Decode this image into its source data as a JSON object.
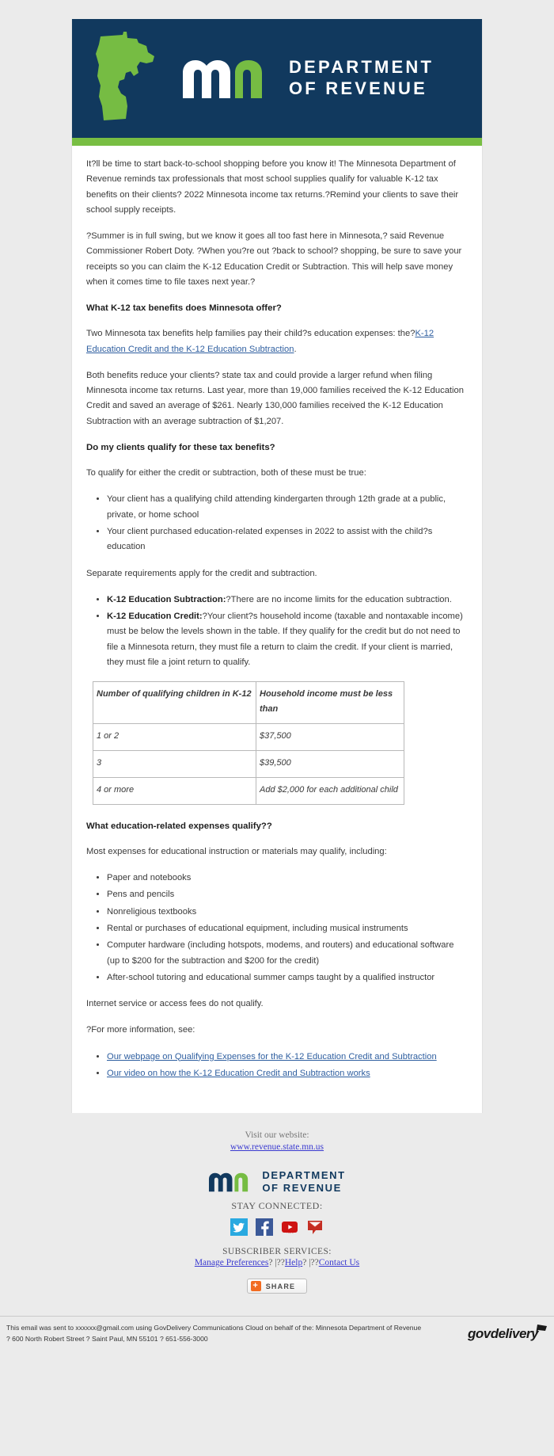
{
  "banner": {
    "map_icon": "minnesota-state-outline",
    "logo_icon": "mn-monogram",
    "dept_line1": "DEPARTMENT",
    "dept_line2": "OF REVENUE"
  },
  "article": {
    "intro": "It?ll be time to start back-to-school shopping before you know it! The Minnesota Department of Revenue reminds tax professionals that most school supplies qualify for valuable K-12 tax benefits on their clients? 2022 Minnesota income tax returns.?Remind your clients to save their school supply receipts.",
    "quote": "?Summer is in full swing, but we know it goes all too fast here in Minnesota,? said Revenue Commissioner Robert Doty. ?When you?re out ?back to school? shopping, be sure to save your receipts so you can claim the K-12 Education Credit or Subtraction. This will help save money when it comes time to file taxes next year.?",
    "heading_benefits": "What K-12 tax benefits does Minnesota offer?",
    "two_benefits_lead": "Two Minnesota tax benefits help families pay their child?s education expenses: the?",
    "two_benefits_link": "K-12 Education Credit and the K-12 Education Subtraction",
    "two_benefits_tail": ".",
    "both_benefits": "Both benefits reduce your clients? state tax and could provide a larger refund when filing Minnesota income tax returns. Last year, more than 19,000 families received the K-12 Education Credit and saved an average of $261. Nearly 130,000 families received the K-12 Education Subtraction with an average subtraction of $1,207.",
    "heading_qualify": "Do my clients qualify for these tax benefits?",
    "qualify_lead": "To qualify for either the credit or subtraction, both of these must be true:",
    "qualify_items": [
      "Your client has a qualifying child attending kindergarten through 12th grade at a public, private, or home school",
      "Your client purchased education-related expenses in 2022 to assist with the child?s education"
    ],
    "separate_requirements": "Separate requirements apply for the credit and subtraction.",
    "requirement_items": [
      {
        "label": "K-12 Education Subtraction:",
        "text": "?There are no income limits for the education subtraction."
      },
      {
        "label": "K-12 Education Credit:",
        "text": "?Your client?s household income (taxable and nontaxable income) must be below the levels shown in the table. If they qualify for the credit but do not need to file a Minnesota return, they must file a return to claim the credit. If your client is married, they must file a joint return to qualify."
      }
    ],
    "heading_expenses": "What education-related expenses qualify??",
    "expenses_lead": "Most expenses for educational instruction or materials may qualify, including:",
    "expense_items": [
      "Paper and notebooks",
      "Pens and pencils",
      "Nonreligious textbooks",
      "Rental or purchases of educational equipment, including musical instruments",
      "Computer hardware (including hotspots, modems, and routers) and educational software (up to $200 for the subtraction and $200 for the credit)",
      "After-school tutoring and educational summer camps taught by a qualified instructor"
    ],
    "internet_note": "Internet service or access fees do not qualify.",
    "more_info_lead": "?For more information, see:",
    "more_info_links": [
      "Our webpage on Qualifying Expenses for the K-12 Education Credit and Subtraction",
      "Our video on how the K-12 Education Credit and Subtraction works"
    ]
  },
  "income_table": {
    "headers": [
      "Number of qualifying children in K-12",
      "Household income must be less than"
    ],
    "rows": [
      [
        "1 or 2",
        "$37,500"
      ],
      [
        "3",
        "$39,500"
      ],
      [
        "4 or more",
        "Add $2,000 for each additional child"
      ]
    ]
  },
  "footer": {
    "visit_label": "Visit our website:",
    "visit_link": "www.revenue.state.mn.us",
    "dept_line1": "DEPARTMENT",
    "dept_line2": "OF REVENUE",
    "stay_connected": "STAY CONNECTED:",
    "social": [
      {
        "name": "twitter-icon"
      },
      {
        "name": "facebook-icon"
      },
      {
        "name": "youtube-icon"
      },
      {
        "name": "email-icon"
      }
    ],
    "subscriber_label": "SUBSCRIBER SERVICES:",
    "manage_preferences": "Manage Preferences",
    "sep1": "? |??",
    "help": "Help",
    "sep2": "? |??",
    "contact_us": "Contact Us",
    "share_label": "SHARE",
    "share_icon": "share-plus-icon"
  },
  "legal": {
    "text": "This email was sent to xxxxxx@gmail.com using GovDelivery Communications Cloud on behalf of the: Minnesota Department of Revenue ? 600 North Robert Street ? Saint Paul, MN 55101 ? 651-556-3000",
    "brand": "govdelivery",
    "brand_icon": "govdelivery-flag-icon"
  }
}
